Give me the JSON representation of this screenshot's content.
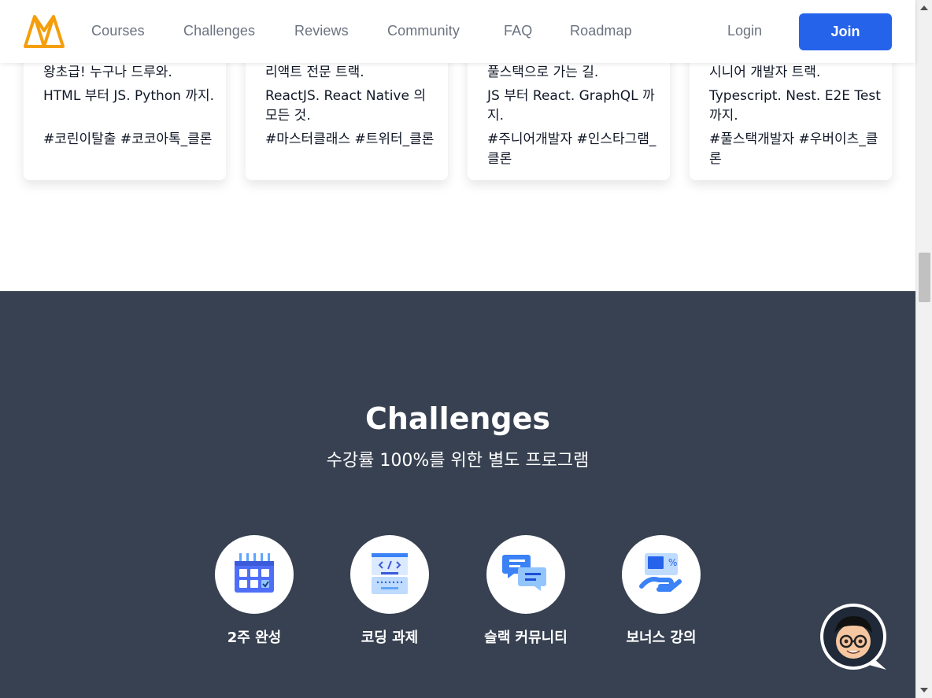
{
  "header": {
    "nav": [
      "Courses",
      "Challenges",
      "Reviews",
      "Community",
      "FAQ",
      "Roadmap"
    ],
    "login": "Login",
    "join": "Join",
    "accent": "#2563eb",
    "logo_color": "#f59e0b"
  },
  "cards": [
    {
      "l1": "왕초급! 누구나 드루와.",
      "l2": "HTML 부터 JS. Python 까지.",
      "l3": "#코린이탈출 #코코아톡_클론"
    },
    {
      "l1": "리액트 전문 트랙.",
      "l2": "ReactJS. React Native 의 모든 것.",
      "l3": "#마스터클래스 #트위터_클론"
    },
    {
      "l1": "풀스택으로 가는 길.",
      "l2": "JS 부터 React. GraphQL 까지.",
      "l3": "#주니어개발자 #인스타그램_클론"
    },
    {
      "l1": "시니어 개발자 트랙.",
      "l2": "Typescript. Nest. E2E Test 까지.",
      "l3": "#풀스택개발자 #우버이츠_클론"
    }
  ],
  "challenges": {
    "title": "Challenges",
    "subtitle": "수강률 100%를 위한 별도 프로그램",
    "background": "#374151",
    "features": [
      {
        "label": "2주 완성",
        "icon": "calendar-icon"
      },
      {
        "label": "코딩 과제",
        "icon": "code-window-icon"
      },
      {
        "label": "슬랙 커뮤니티",
        "icon": "chat-bubbles-icon"
      },
      {
        "label": "보너스 강의",
        "icon": "bonus-hand-icon"
      }
    ]
  },
  "chat_widget": {
    "icon": "avatar-chat-icon"
  }
}
